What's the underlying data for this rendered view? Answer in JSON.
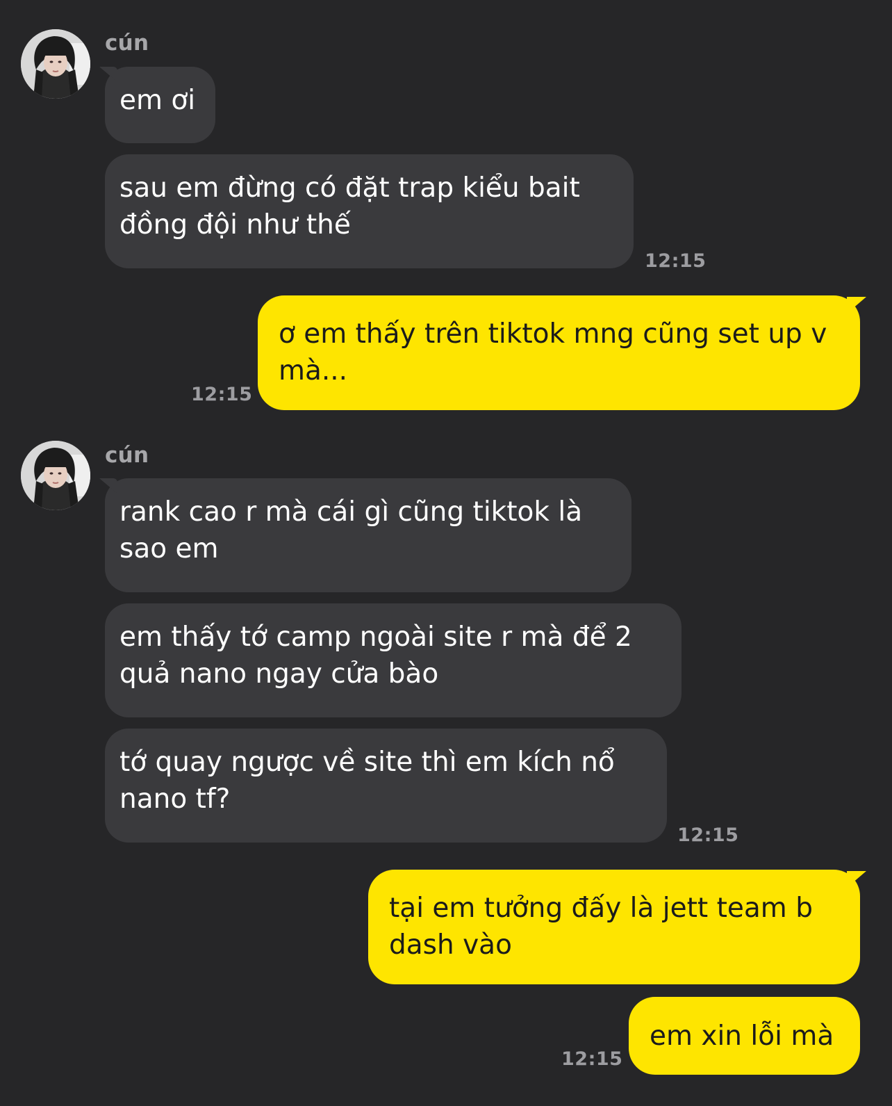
{
  "groups": [
    {
      "sender": "cún",
      "avatar_icon": "profile-photo-avatar",
      "messages": [
        {
          "text": "em ơi"
        },
        {
          "text": "sau em đừng có đặt trap kiểu bait đồng đội như thế"
        }
      ],
      "time": "12:15"
    },
    {
      "sender": "cún",
      "avatar_icon": "profile-photo-avatar",
      "messages": [
        {
          "text": "rank cao r mà cái gì cũng tiktok là sao em"
        },
        {
          "text": "em thấy tớ camp ngoài site r mà để 2 quả nano ngay cửa bào"
        },
        {
          "text": "tớ quay ngược về site thì em kích nổ nano tf?"
        }
      ],
      "time": "12:15"
    }
  ],
  "outgoing": [
    {
      "text": "ơ em thấy trên tiktok mng cũng set up v mà...",
      "time": "12:15"
    },
    {
      "text": "tại em tưởng đấy là jett team b dash vào"
    },
    {
      "text": "em xin lỗi mà",
      "time": "12:15"
    }
  ],
  "colors": {
    "background": "#262628",
    "incoming_bubble": "#3a3a3d",
    "outgoing_bubble": "#fee500",
    "timestamp": "#9d9da1",
    "sender_name": "#a7a7aa"
  }
}
